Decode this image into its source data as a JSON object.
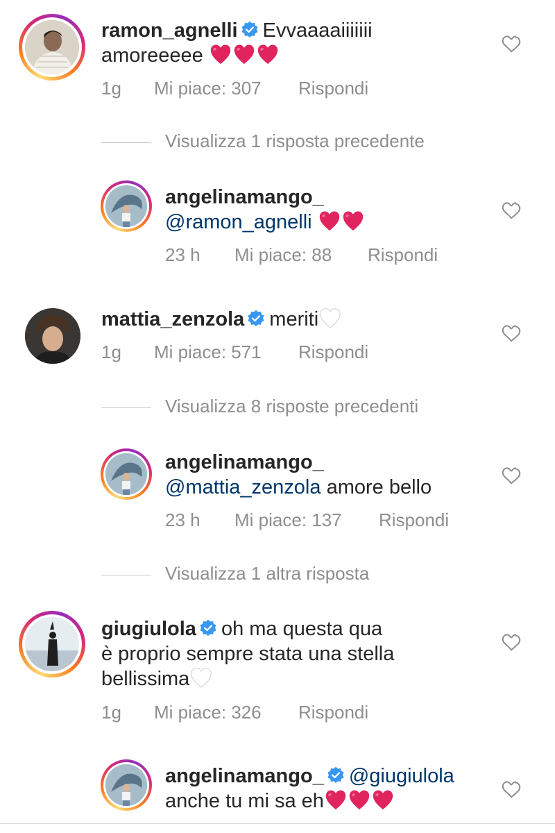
{
  "comments": [
    {
      "username": "ramon_agnelli",
      "text": "Evvaaaaiiiiiii",
      "text2": "amoreeeee",
      "time": "1g",
      "likes": "Mi piace: 307",
      "reply": "Rispondi"
    },
    {
      "username": "angelinamango_",
      "mention": "@ramon_agnelli",
      "time": "23 h",
      "likes": "Mi piace: 88",
      "reply": "Rispondi"
    },
    {
      "username": "mattia_zenzola",
      "text": "meriti",
      "time": "1g",
      "likes": "Mi piace: 571",
      "reply": "Rispondi"
    },
    {
      "username": "angelinamango_",
      "mention": "@mattia_zenzola",
      "text": "amore bello",
      "time": "23 h",
      "likes": "Mi piace: 137",
      "reply": "Rispondi"
    },
    {
      "username": "giugiulola",
      "text": "oh ma questa qua",
      "text2": "è proprio sempre stata una stella",
      "text3": "bellissima",
      "time": "1g",
      "likes": "Mi piace: 326",
      "reply": "Rispondi"
    },
    {
      "username": "angelinamango_",
      "mention": "@giugiulola",
      "text2": "anche tu mi sa eh"
    }
  ],
  "view_replies": [
    "Visualizza 1 risposta precedente",
    "Visualizza 8 risposte precedenti",
    "Visualizza 1 altra risposta"
  ],
  "colors": {
    "verified": "#3897f0",
    "red_heart": "#e0245e",
    "mention": "#00376b",
    "meta": "#8e8e8e"
  },
  "icons": [
    "verified-badge-icon",
    "heart-outline-icon",
    "red-heart-emoji",
    "white-heart-emoji"
  ]
}
